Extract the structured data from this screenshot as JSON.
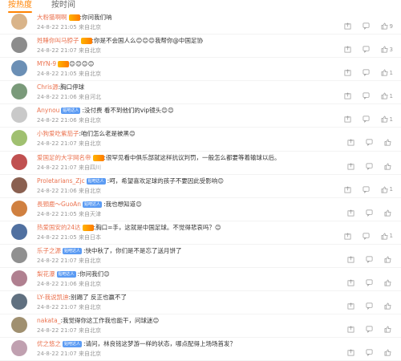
{
  "tabs": [
    {
      "label": "按热度",
      "active": true
    },
    {
      "label": "按时间",
      "active": false
    }
  ],
  "comments": [
    {
      "user": "大粉猫啊啊",
      "vip": true,
      "badge": "",
      "text": ":你问我们呐",
      "time": "24-8-22 21:05",
      "loc": "来自北京",
      "like": "9",
      "avatar": "#d9b48a"
    },
    {
      "user": "姓睡你叫马脖子",
      "vip": true,
      "badge": "",
      "text": ":你是不会国人么😊😊😊我帮你@中国足协",
      "time": "24-8-22 21:07",
      "loc": "来自北京",
      "like": "3",
      "avatar": "#8c8c8c"
    },
    {
      "user": "MYN-9",
      "vip": true,
      "badge": "",
      "text": "😊😊😊😊",
      "time": "24-8-22 21:05",
      "loc": "来自北京",
      "like": "1",
      "avatar": "#6b8fb5"
    },
    {
      "user": "Chris源",
      "vip": false,
      "badge": "",
      "text": ":胸口停球",
      "time": "24-8-22 21:06",
      "loc": "来自河北",
      "like": "1",
      "avatar": "#7a9a7a"
    },
    {
      "user": "Anynou",
      "vip": false,
      "badge": "贴吧达人",
      "text": ":没付费 看不到他们的vip镜头😊😊",
      "time": "24-8-22 21:06",
      "loc": "来自北京",
      "like": "1",
      "avatar": "#c9c9c9"
    },
    {
      "user": "小狗爱吃紫茄子",
      "vip": false,
      "badge": "",
      "text": ":咱们怎么老是被黑😊",
      "time": "24-8-22 21:07",
      "loc": "来自北京",
      "like": "",
      "avatar": "#a0c070"
    },
    {
      "user": "爱国足的大字网名帝",
      "vip": true,
      "badge": "",
      "text": ":很罕见看中俱乐部就这样抗议判罚，一般怎么都要等着输球以后。",
      "time": "24-8-22 21:07",
      "loc": "来自四川",
      "like": "",
      "avatar": "#c05050"
    },
    {
      "user": "Proletarians_Zjc",
      "vip": false,
      "badge": "贴吧达人",
      "text": ":呵，希望喜欢足球的孩子不要因此受影响😊",
      "time": "24-8-22 21:06",
      "loc": "来自北京",
      "like": "1",
      "avatar": "#8a6050"
    },
    {
      "user": "長頸鹿～GuoAn",
      "vip": false,
      "badge": "贴吧达人",
      "text": ":我也想知道😊",
      "time": "24-8-22 21:05",
      "loc": "来自天津",
      "like": "",
      "avatar": "#d08040"
    },
    {
      "user": "热爱国安的24达",
      "vip": true,
      "badge": "",
      "text": ":胸口=手，这就是中国足球。不觉得悲哀吗？😊",
      "time": "24-8-22 21:05",
      "loc": "来自日本",
      "like": "1",
      "avatar": "#5070a0"
    },
    {
      "user": "乐子之源",
      "vip": false,
      "badge": "贴吧达人",
      "text": ":快中秋了，你们是不是忘了送月饼了",
      "time": "24-8-22 21:07",
      "loc": "来自北京",
      "like": "",
      "avatar": "#909090"
    },
    {
      "user": "梨花瀑",
      "vip": false,
      "badge": "贴吧达人",
      "text": ":你问我们😊",
      "time": "24-8-22 21:06",
      "loc": "来自北京",
      "like": "",
      "avatar": "#b08090"
    },
    {
      "user": "LY-我说凯迪",
      "vip": false,
      "badge": "",
      "text": ":别踢了 反正也赢不了",
      "time": "24-8-22 21:07",
      "loc": "来自北京",
      "like": "",
      "avatar": "#607080"
    },
    {
      "user": "nakata_",
      "vip": false,
      "badge": "",
      "text": ":我觉得你这工作我也能干，问球迷😊",
      "time": "24-8-22 21:07",
      "loc": "来自北京",
      "like": "",
      "avatar": "#a09070"
    },
    {
      "user": "优之悠之",
      "vip": false,
      "badge": "贴吧达人",
      "text": ":请问，林良铭这梦游一样的状态，哪点配得上场场首发？",
      "time": "24-8-22 21:07",
      "loc": "来自北京",
      "like": "",
      "avatar": "#c0a0b0"
    }
  ]
}
